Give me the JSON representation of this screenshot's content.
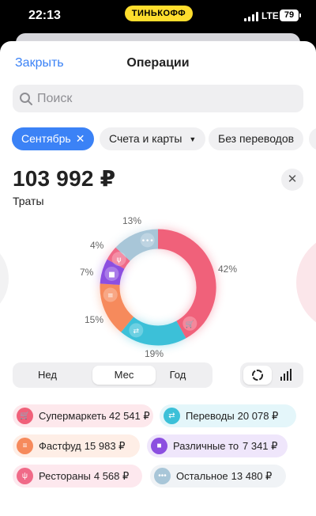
{
  "status_bar": {
    "time": "22:13",
    "carrier": "ТИНЬКОФФ",
    "network": "LTE",
    "battery": "79"
  },
  "header": {
    "close_label": "Закрыть",
    "title": "Операции"
  },
  "search": {
    "placeholder": "Поиск"
  },
  "filters": [
    {
      "label": "Сентябрь",
      "active": true,
      "icon": "close-icon"
    },
    {
      "label": "Счета и карты",
      "active": false,
      "icon": "caret-down-icon"
    },
    {
      "label": "Без переводов",
      "active": false
    }
  ],
  "summary": {
    "amount": "103 992 ₽",
    "label": "Траты"
  },
  "donut": {
    "slices": [
      {
        "name": "Супермаркеты",
        "percent": 42,
        "label": "42%",
        "color": "#f0617a",
        "icon": "cart-icon"
      },
      {
        "name": "Переводы",
        "percent": 19,
        "label": "19%",
        "color": "#3cc0d8",
        "icon": "transfer-icon"
      },
      {
        "name": "Фастфуд",
        "percent": 15,
        "label": "15%",
        "color": "#f68a5c",
        "icon": "burger-icon"
      },
      {
        "name": "Различные товары",
        "percent": 7,
        "label": "7%",
        "color": "#8c4fe0",
        "icon": "box-icon"
      },
      {
        "name": "Рестораны",
        "percent": 4,
        "label": "4%",
        "color": "#f06a88",
        "icon": "cutlery-icon"
      },
      {
        "name": "Остальное",
        "percent": 13,
        "label": "13%",
        "color": "#a8c6d8",
        "icon": "dots-icon"
      }
    ]
  },
  "period": {
    "tabs": [
      "Нед",
      "Мес",
      "Год"
    ],
    "active": "Мес"
  },
  "view": {
    "active": "donut"
  },
  "categories": [
    {
      "name": "Супермаркеты",
      "value": "42 541 ₽",
      "color": "#f0617a",
      "bg": "#fde8ec"
    },
    {
      "name": "Переводы",
      "value": "20 078 ₽",
      "color": "#3cc0d8",
      "bg": "#e4f6fa"
    },
    {
      "name": "Фастфуд",
      "value": "15 983 ₽",
      "color": "#f68a5c",
      "bg": "#feeee6"
    },
    {
      "name": "Различные товары",
      "value": "7 341 ₽",
      "color": "#8c4fe0",
      "bg": "#efe6fb"
    },
    {
      "name": "Рестораны",
      "value": "4 568 ₽",
      "color": "#f06a88",
      "bg": "#fde8ee"
    },
    {
      "name": "Остальное",
      "value": "13 480 ₽",
      "color": "#a8c6d8",
      "bg": "#f0f3f6"
    }
  ]
}
